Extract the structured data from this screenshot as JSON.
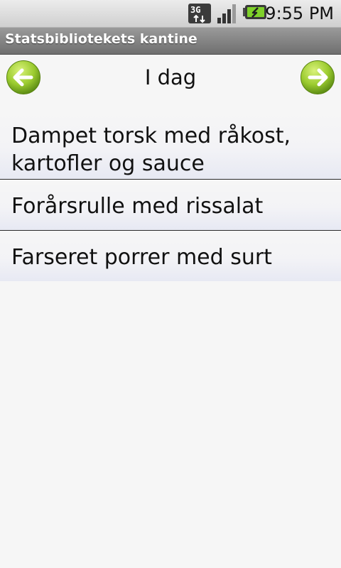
{
  "status_bar": {
    "network_type": "3G",
    "signal_icon": "signal-strength-icon",
    "battery_icon": "battery-charging-icon",
    "time": "9:55 PM"
  },
  "app": {
    "title": "Statsbibliotekets kantine"
  },
  "navigation": {
    "day_label": "I dag",
    "prev_icon": "left-arrow-icon",
    "next_icon": "right-arrow-icon"
  },
  "menu": {
    "items": [
      {
        "label": "Dampet torsk med råkost, kartofler og sauce"
      },
      {
        "label": "Forårsrulle med rissalat"
      },
      {
        "label": "Farseret porrer med surt"
      }
    ]
  },
  "colors": {
    "accent_green": "#8cc63f",
    "title_bar": "#7f7f7f"
  }
}
